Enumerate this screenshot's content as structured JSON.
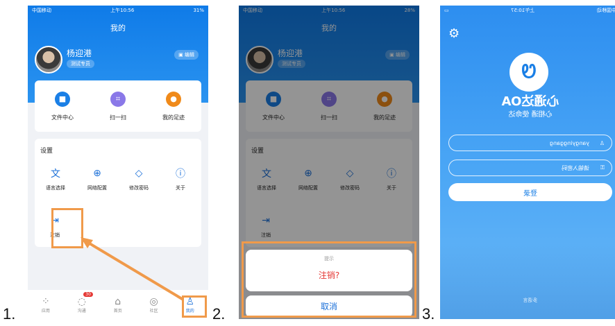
{
  "labels": {
    "one": "1.",
    "two": "2.",
    "three": "3."
  },
  "status_bar": {
    "carrier": "中国移动",
    "time": "上午10:56",
    "battery1": "31%",
    "battery2": "28%",
    "time3": "上午10:57"
  },
  "profile": {
    "title": "我的",
    "name": "杨迎港",
    "role": "测试专员",
    "edit": "编辑"
  },
  "quick_actions": [
    {
      "label": "文件中心",
      "icon": "folder-icon",
      "color": "#1a7fe6"
    },
    {
      "label": "扫一扫",
      "icon": "scan-icon",
      "color": "#8a78e8"
    },
    {
      "label": "我的足迹",
      "icon": "footprint-icon",
      "color": "#f08a1a"
    }
  ],
  "settings": {
    "title": "设置",
    "items": [
      {
        "label": "语言选择",
        "icon": "language-icon"
      },
      {
        "label": "网络配置",
        "icon": "globe-icon"
      },
      {
        "label": "修改密码",
        "icon": "shield-icon"
      },
      {
        "label": "关于",
        "icon": "info-icon"
      }
    ],
    "logout": {
      "label": "注销",
      "icon": "logout-icon"
    }
  },
  "tabbar": [
    {
      "label": "应用",
      "icon": "apps-icon"
    },
    {
      "label": "沟通",
      "icon": "chat-icon",
      "badge": "30"
    },
    {
      "label": "首页",
      "icon": "home-icon"
    },
    {
      "label": "社区",
      "icon": "community-icon"
    },
    {
      "label": "我的",
      "icon": "user-icon"
    }
  ],
  "dialog": {
    "hint": "提示",
    "logout_question": "注销?",
    "cancel": "取消"
  },
  "login": {
    "app_name": "心通达OA",
    "slogan": "心相通 使命达",
    "username": "yangyinggang",
    "password_placeholder": "请输入密码",
    "login_button": "登录",
    "footer": "多语言"
  },
  "colors": {
    "highlight": "#f09a4a",
    "brand": "#1a7fe6",
    "danger": "#e53935"
  }
}
